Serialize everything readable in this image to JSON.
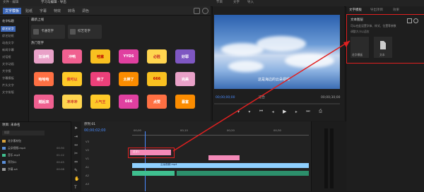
{
  "titlebar": {
    "left": "文件 · 编辑",
    "center": "学习与编辑 · 导出",
    "workspace_tabs": [
      "节目",
      "文字",
      "导入"
    ]
  },
  "main_tabs": [
    "文字模板",
    "贴纸",
    "字幕",
    "特效",
    "转场",
    "调色"
  ],
  "categories": [
    "花字标题",
    "综艺花字",
    "综艺贴纸",
    "动态文字",
    "新闻字幕",
    "对话框",
    "文字动画",
    "大字报",
    "字幕模板",
    "片头文字",
    "文字排版"
  ],
  "section": {
    "title": "最新上线",
    "cards": [
      {
        "label": "卡通花字"
      },
      {
        "label": "综艺花字"
      }
    ],
    "popular_title": "热门花字"
  },
  "stickers": [
    "加油鸭",
    "冲鸭",
    "哇塞",
    "YYDS",
    "必胜",
    "好耶",
    "哈哈哈",
    "我可以",
    "绝了",
    "太棒了",
    "666",
    "完美",
    "燃起来",
    "冲冲冲",
    "人气王",
    "666",
    "点赞",
    "暴富",
    "神仙",
    "厉害",
    "开心"
  ],
  "monitor": {
    "timecode_left": "00;00;00;00",
    "timecode_right": "00;00;30;00",
    "fit": "适合",
    "subtitle": "这是海边的云朵视频"
  },
  "right_panel": {
    "tabs": [
      "文字模板",
      "导出项目",
      "效果"
    ],
    "title": "文本图层",
    "desc": "可以在此设置字体、样式、位置等参数",
    "sub": "调整大小以适应"
  },
  "right_items": [
    {
      "label": "花字模板"
    },
    {
      "label": "文本"
    }
  ],
  "project": {
    "title": "项目: 未命名",
    "search_placeholder": "搜索",
    "items": [
      "花字素材包",
      "云朵视频.mp4",
      "音乐.mp3",
      "序列01",
      "字幕.srt"
    ],
    "times": [
      "00:30",
      "01:12",
      "00:45",
      "00:08"
    ]
  },
  "timeline": {
    "sequence": "序列 01",
    "timecode": "00;00;02;00",
    "tracks": [
      "V3",
      "V2",
      "V1",
      "A1",
      "A2",
      "A3"
    ],
    "clip_v2": "花字1",
    "clip_v1": "云朵视频.mp4",
    "ruler": [
      "00;00",
      "00;10",
      "00;20",
      "00;30"
    ]
  },
  "colors": {
    "accent": "#3c66b5",
    "highlight": "#e02020",
    "video_clip": "#8fd0ff",
    "audio_clip": "#3fbf8f",
    "pink_clip": "#f48ab8"
  }
}
